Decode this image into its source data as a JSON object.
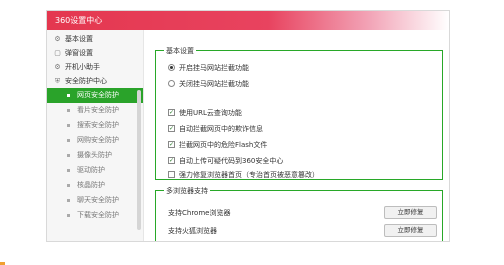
{
  "window": {
    "title": "360设置中心"
  },
  "sidebar": {
    "top_items": [
      {
        "icon": "gear-icon",
        "glyph": "⚙",
        "label": "基本设置"
      },
      {
        "icon": "window-icon",
        "glyph": "▢",
        "label": "弹窗设置"
      },
      {
        "icon": "startup-icon",
        "glyph": "⚙",
        "label": "开机小助手"
      },
      {
        "icon": "shield-icon",
        "glyph": "⛨",
        "label": "安全防护中心"
      }
    ],
    "sub_items": [
      {
        "label": "网页安全防护",
        "active": true
      },
      {
        "label": "看片安全防护",
        "active": false
      },
      {
        "label": "搜索安全防护",
        "active": false
      },
      {
        "label": "网购安全防护",
        "active": false
      },
      {
        "label": "摄像头防护",
        "active": false
      },
      {
        "label": "驱动防护",
        "active": false
      },
      {
        "label": "核晶防护",
        "active": false
      },
      {
        "label": "聊天安全防护",
        "active": false
      },
      {
        "label": "下载安全防护",
        "active": false
      }
    ]
  },
  "basic_settings": {
    "legend": "基本设置",
    "radios": [
      {
        "label": "开启挂马网站拦截功能",
        "selected": true
      },
      {
        "label": "关闭挂马网站拦截功能",
        "selected": false
      }
    ],
    "checkboxes": [
      {
        "label": "使用URL云查询功能",
        "checked": true
      },
      {
        "label": "自动拦截网页中的欺诈信息",
        "checked": true
      },
      {
        "label": "拦截网页中的危险Flash文件",
        "checked": true
      },
      {
        "label": "自动上传可疑代码到360安全中心",
        "checked": true
      },
      {
        "label": "强力修复浏览器首页（专治首页被恶意篡改）",
        "checked": false
      }
    ]
  },
  "multi_browser": {
    "legend": "多浏览器支持",
    "rows": [
      {
        "label": "支持Chrome浏览器",
        "button": "立即修复"
      },
      {
        "label": "支持火狐浏览器",
        "button": "立即修复"
      }
    ]
  },
  "colors": {
    "accent_green": "#2aa32a",
    "title_red": "#e4374f"
  }
}
